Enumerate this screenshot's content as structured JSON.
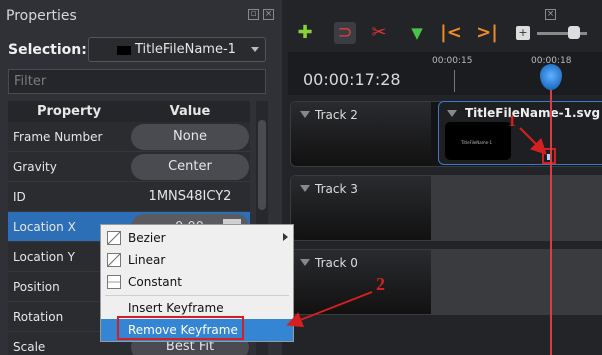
{
  "properties_panel": {
    "title": "Properties",
    "selection_label": "Selection:",
    "selection_value": "TitleFileName-1",
    "filter_placeholder": "Filter",
    "columns": [
      "Property",
      "Value"
    ],
    "rows": [
      {
        "name": "Frame Number",
        "value": "None"
      },
      {
        "name": "Gravity",
        "value": "Center"
      },
      {
        "name": "ID",
        "value": "1MNS48ICY2"
      },
      {
        "name": "Location X",
        "value": "0.00"
      },
      {
        "name": "Location Y",
        "value": ""
      },
      {
        "name": "Position",
        "value": ""
      },
      {
        "name": "Rotation",
        "value": ""
      },
      {
        "name": "Scale",
        "value": "Best Fit"
      }
    ]
  },
  "context_menu": {
    "items": [
      "Bezier",
      "Linear",
      "Constant",
      "Insert Keyframe",
      "Remove Keyframe"
    ]
  },
  "timeline": {
    "timecode": "00:00:17:28",
    "ticks": [
      "00:00:15",
      "00:00:18"
    ],
    "tracks": [
      "Track 2",
      "Track 3",
      "Track 0"
    ],
    "clip_name": "TitleFileName-1.svg",
    "clip_thumb_text": "TitleFileName-1",
    "icons": [
      "add-track-icon",
      "magnet-icon",
      "razor-icon",
      "marker-icon",
      "previous-marker-icon",
      "next-marker-icon",
      "center-playhead-icon"
    ]
  },
  "annotations": {
    "label_1": "1",
    "label_2": "2",
    "color": "#d42020"
  }
}
